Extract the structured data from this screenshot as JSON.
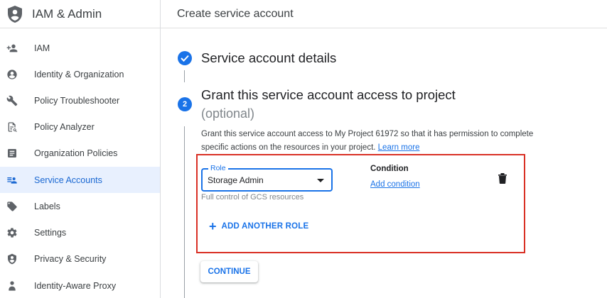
{
  "sidebar": {
    "title": "IAM & Admin",
    "items": [
      {
        "label": "IAM",
        "icon": "person-add-icon"
      },
      {
        "label": "Identity & Organization",
        "icon": "account-circle-icon"
      },
      {
        "label": "Policy Troubleshooter",
        "icon": "wrench-icon"
      },
      {
        "label": "Policy Analyzer",
        "icon": "document-search-icon"
      },
      {
        "label": "Organization Policies",
        "icon": "list-box-icon"
      },
      {
        "label": "Service Accounts",
        "icon": "service-account-icon",
        "active": true
      },
      {
        "label": "Labels",
        "icon": "label-icon"
      },
      {
        "label": "Settings",
        "icon": "gear-icon"
      },
      {
        "label": "Privacy & Security",
        "icon": "shield-icon"
      },
      {
        "label": "Identity-Aware Proxy",
        "icon": "iap-icon"
      }
    ]
  },
  "main": {
    "page_title": "Create service account",
    "step1": {
      "title": "Service account details"
    },
    "step2": {
      "number": "2",
      "title": "Grant this service account access to project",
      "optional": "(optional)",
      "description": "Grant this service account access to My Project 61972 so that it has permission to complete specific actions on the resources in your project.",
      "learn_more": "Learn more"
    },
    "role": {
      "label": "Role",
      "value": "Storage Admin",
      "hint": "Full control of GCS resources"
    },
    "condition": {
      "label": "Condition",
      "link": "Add condition"
    },
    "add_role": "ADD ANOTHER ROLE",
    "continue": "CONTINUE"
  },
  "colors": {
    "accent": "#1a73e8",
    "highlight_border": "#d93025",
    "active_bg": "#e8f0fe"
  }
}
